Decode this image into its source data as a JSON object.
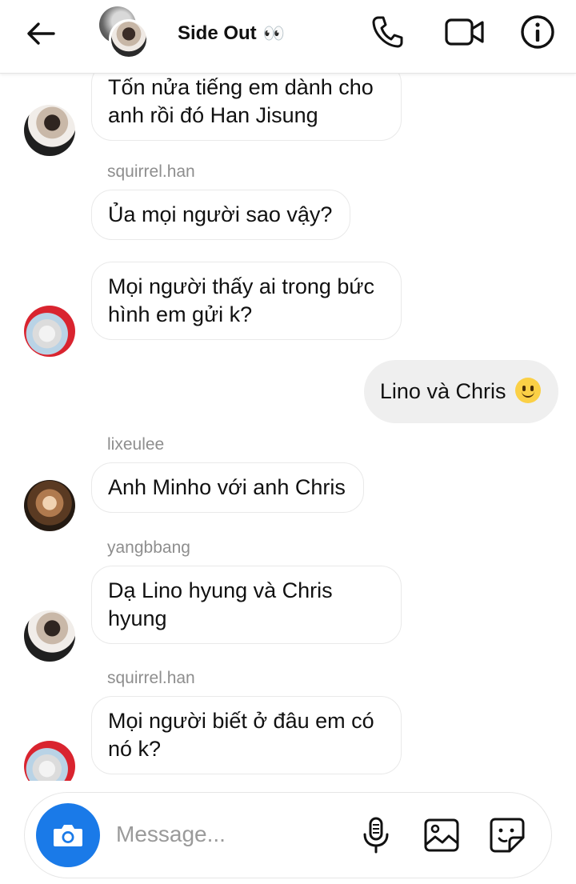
{
  "header": {
    "title": "Side Out",
    "title_emoji": "👀"
  },
  "messages": [
    {
      "id": 1,
      "direction": "in",
      "text": "Tốn nửa tiếng em dành cho anh rồi đó Han Jisung"
    },
    {
      "id": 2,
      "direction": "in",
      "sender": "squirrel.han",
      "text": "Ủa mọi người sao vậy?"
    },
    {
      "id": 3,
      "direction": "in",
      "text": "Mọi người thấy ai trong bức hình em gửi k?"
    },
    {
      "id": 4,
      "direction": "out",
      "text": "Lino và Chris",
      "emoji": "slightly-smiling-face"
    },
    {
      "id": 5,
      "direction": "in",
      "sender": "lixeulee",
      "text": "Anh Minho với anh Chris"
    },
    {
      "id": 6,
      "direction": "in",
      "sender": "yangbbang",
      "text": "Dạ Lino hyung và Chris hyung"
    },
    {
      "id": 7,
      "direction": "in",
      "sender": "squirrel.han",
      "text": "Mọi người biết ở đâu em có nó k?"
    }
  ],
  "composer": {
    "placeholder": "Message...",
    "value": ""
  },
  "icons": {
    "back": "arrow-left-icon",
    "call": "phone-icon",
    "video": "video-camera-icon",
    "info": "info-icon",
    "camera": "camera-icon",
    "mic": "microphone-icon",
    "gallery": "image-icon",
    "sticker": "sticker-icon"
  },
  "colors": {
    "accent": "#1a7ae8",
    "outgoing_bubble": "#efefef",
    "incoming_border": "#e9e9e9",
    "sender_label": "#8e8e8e"
  }
}
